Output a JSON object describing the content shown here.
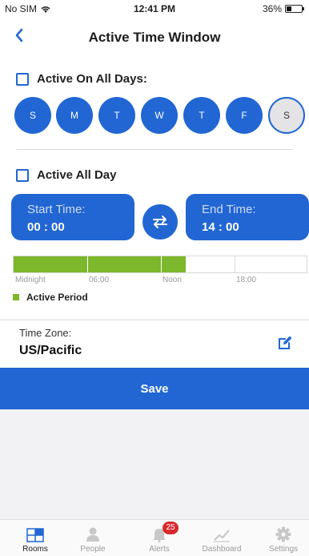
{
  "status_bar": {
    "carrier": "No SIM",
    "time": "12:41 PM",
    "battery": "36%",
    "battery_fraction": 0.36
  },
  "nav": {
    "back_icon": "chevron-left-icon",
    "title": "Active Time Window"
  },
  "days_section": {
    "label": "Active On All Days:",
    "checked": false,
    "days": [
      {
        "label": "S",
        "active": true
      },
      {
        "label": "M",
        "active": true
      },
      {
        "label": "T",
        "active": true
      },
      {
        "label": "W",
        "active": true
      },
      {
        "label": "T",
        "active": true
      },
      {
        "label": "F",
        "active": true
      },
      {
        "label": "S",
        "active": false
      }
    ]
  },
  "all_day": {
    "label": "Active All Day",
    "checked": false
  },
  "start_time": {
    "label": "Start Time:",
    "value": "00 : 00"
  },
  "end_time": {
    "label": "End Time:",
    "value": "14 : 00"
  },
  "swap_icon": "swap-arrows-icon",
  "timeline": {
    "labels": [
      "Midnight",
      "06:00",
      "Noon",
      "18:00"
    ],
    "active_start_hour": 0,
    "active_end_hour": 14,
    "active_color": "#7cb72c"
  },
  "legend": {
    "label": "Active Period"
  },
  "time_zone": {
    "label": "Time Zone:",
    "value": "US/Pacific",
    "edit_icon": "pencil-edit-icon"
  },
  "save_button": {
    "label": "Save"
  },
  "colors": {
    "accent": "#2166d3",
    "badge": "#d9292f"
  },
  "tabs": [
    {
      "label": "Rooms",
      "icon": "rooms-icon",
      "active": true
    },
    {
      "label": "People",
      "icon": "person-icon",
      "active": false
    },
    {
      "label": "Alerts",
      "icon": "bell-icon",
      "active": false,
      "badge": "25"
    },
    {
      "label": "Dashboard",
      "icon": "chart-line-icon",
      "active": false
    },
    {
      "label": "Settings",
      "icon": "gear-icon",
      "active": false
    }
  ]
}
